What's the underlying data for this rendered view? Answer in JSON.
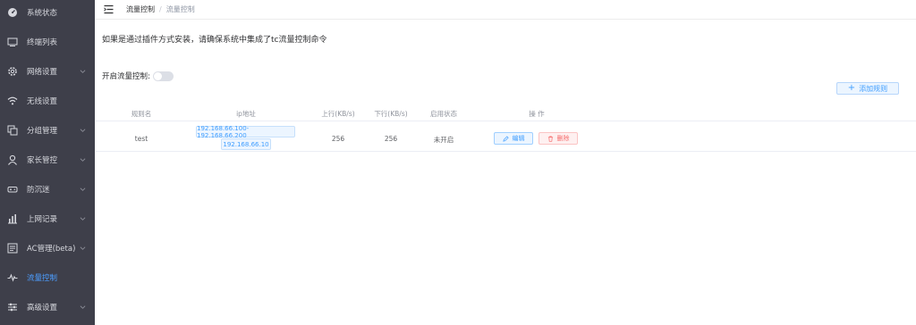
{
  "sidebar": {
    "items": [
      {
        "label": "系统状态",
        "icon": "dashboard-icon",
        "has_children": false
      },
      {
        "label": "终端列表",
        "icon": "monitor-icon",
        "has_children": false
      },
      {
        "label": "网络设置",
        "icon": "gear-icon",
        "has_children": true
      },
      {
        "label": "无线设置",
        "icon": "wifi-icon",
        "has_children": false
      },
      {
        "label": "分组管理",
        "icon": "copy-icon",
        "has_children": true
      },
      {
        "label": "家长管控",
        "icon": "user-icon",
        "has_children": true
      },
      {
        "label": "防沉迷",
        "icon": "gamepad-icon",
        "has_children": true
      },
      {
        "label": "上网记录",
        "icon": "bar-chart-icon",
        "has_children": true
      },
      {
        "label": "AC管理(beta)",
        "icon": "list-icon",
        "has_children": true
      },
      {
        "label": "流量控制",
        "icon": "pulse-icon",
        "has_children": false,
        "active": true
      },
      {
        "label": "高级设置",
        "icon": "sliders-icon",
        "has_children": true
      }
    ]
  },
  "header": {
    "breadcrumb": [
      "流量控制",
      "流量控制"
    ],
    "separator": "/"
  },
  "main": {
    "notice": "如果是通过插件方式安装，请确保系统中集成了tc流量控制命令",
    "toggle_label": "开启流量控制:",
    "toggle_on": false,
    "add_label": "添加规则",
    "table": {
      "headers": [
        "规则名",
        "ip地址",
        "上行(KB/s)",
        "下行(KB/s)",
        "启用状态",
        "操 作"
      ],
      "rows": [
        {
          "name": "test",
          "ips": [
            "192.168.66.100-192.168.66.200",
            "192.168.66.10"
          ],
          "up": "256",
          "down": "256",
          "status": "未开启",
          "edit_label": "编辑",
          "delete_label": "删除"
        }
      ]
    }
  },
  "colors": {
    "sidebar_bg": "#3e3f4a",
    "active": "#4c9dff",
    "primary": "#409eff",
    "danger": "#f56c6c"
  }
}
